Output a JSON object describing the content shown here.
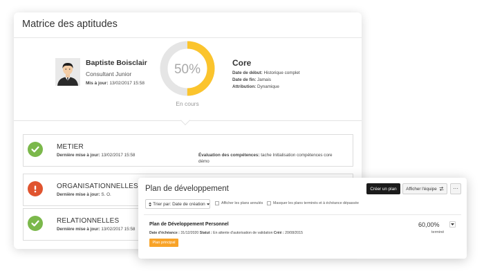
{
  "matrix": {
    "title": "Matrice des aptitudes",
    "profile": {
      "name": "Baptiste Boisclair",
      "role": "Consultant Junior",
      "updated_label": "Mis à jour:",
      "updated_value": "13/02/2017 15:58"
    },
    "progress": {
      "percent_text": "50%",
      "value": 0.5,
      "status": "En cours",
      "track_color": "#e5e5e5",
      "fill_color": "#fbc42d"
    },
    "plan": {
      "name": "Core",
      "start_label": "Date de début:",
      "start_value": "Historique complet",
      "end_label": "Date de fin:",
      "end_value": "Jamais",
      "attribution_label": "Attribution:",
      "attribution_value": "Dynamique"
    },
    "skills": [
      {
        "title": "METIER",
        "status": "ok",
        "icon": "check-icon",
        "updated_label": "Dernière mise à jour:",
        "updated_value": "13/02/2017 15:58",
        "eval_label": "Évaluation des compétences:",
        "eval_value": "tache Initialisation compétences core démo"
      },
      {
        "title": "ORGANISATIONNELLES",
        "status": "warning",
        "icon": "exclamation-icon",
        "updated_label": "Dernière mise à jour:",
        "updated_value": "S. O."
      },
      {
        "title": "RELATIONNELLES",
        "status": "ok",
        "icon": "check-icon",
        "updated_label": "Dernière mise à jour:",
        "updated_value": "13/02/2017 15:58"
      }
    ]
  },
  "dev": {
    "title": "Plan de développement",
    "create_button": "Créer un plan",
    "team_button": "Afficher l'équipe",
    "more_button": "···",
    "sort_label": "Trier par: Date de création",
    "filter_cancelled": "Afficher les plans annulés",
    "filter_hidden": "Masquer les plans terminés et à échéance dépassée",
    "item": {
      "title": "Plan de Développement Personnel",
      "due_label": "Date d'échéance :",
      "due_value": "31/12/2020",
      "status_label": "Statut :",
      "status_value": "En attente d'autorisation de validation",
      "created_label": "Créé :",
      "created_value": "20/08/2015",
      "badge": "Plan principal",
      "percent": "60,00%",
      "done_label": "terminé"
    }
  },
  "colors": {
    "ok": "#7bb84b",
    "warning": "#e0542f",
    "badge": "#f8a328",
    "primary_button": "#1b1b1b"
  }
}
